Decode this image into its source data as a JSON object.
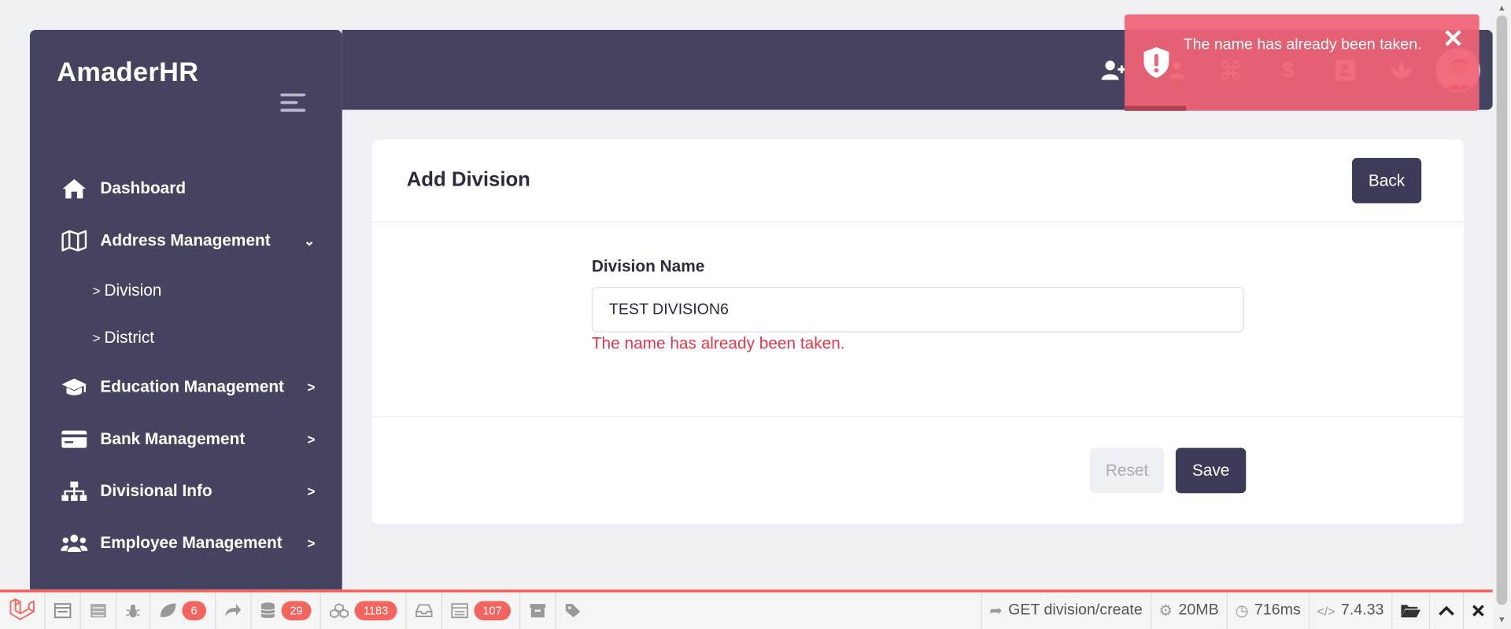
{
  "sidebar": {
    "brand": "AmaderHR",
    "items": [
      {
        "label": "Dashboard"
      },
      {
        "label": "Address Management"
      },
      {
        "label": "Division"
      },
      {
        "label": "District"
      },
      {
        "label": "Education Management"
      },
      {
        "label": "Bank Management"
      },
      {
        "label": "Divisional Info"
      },
      {
        "label": "Employee Management"
      }
    ]
  },
  "topbar": {
    "icons": [
      "user-plus-icon",
      "users-icon",
      "command-icon",
      "dollar-icon",
      "contact-card-icon",
      "lotus-icon"
    ],
    "dollar_glyph": "$"
  },
  "form": {
    "title": "Add Division",
    "back_label": "Back",
    "field_label": "Division Name",
    "field_value": "TEST DIVISION6",
    "error": "The name has already been taken.",
    "reset_label": "Reset",
    "save_label": "Save"
  },
  "toast": {
    "message": "The name has already been taken.",
    "color": "#f06274"
  },
  "debugbar": {
    "badges": {
      "views": "6",
      "queries": "29",
      "models": "1183",
      "gate": "107"
    },
    "route": "GET division/create",
    "memory": "20MB",
    "time": "716ms",
    "php_version": "7.4.33"
  },
  "colors": {
    "sidebar": "#454460",
    "primary_button": "#3d3c58",
    "error": "#e5364f"
  }
}
